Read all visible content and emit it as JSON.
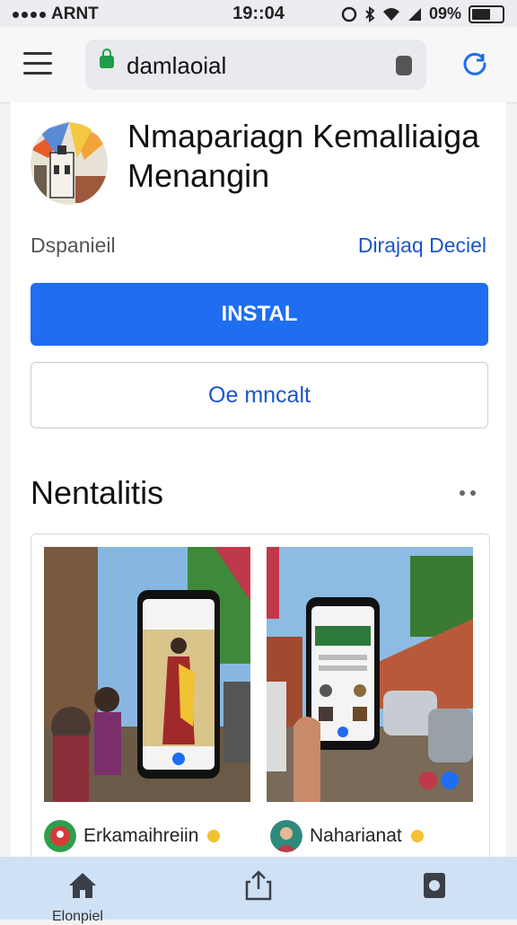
{
  "status_bar": {
    "carrier": "ARNT",
    "time": "19::04",
    "battery_percent": "09%"
  },
  "address_bar": {
    "url": "damlaoial"
  },
  "app": {
    "title": "Nmapariagn Kemalliaiga Menangin",
    "developer": "Dspanieil",
    "category_link": "Dirajaq Deciel"
  },
  "buttons": {
    "install": "INSTAL",
    "secondary": "Oe mncalt"
  },
  "screenshots_section": {
    "title": "Nentalitis",
    "developers": [
      {
        "name": "Erkamaihreiin"
      },
      {
        "name": "Naharianat"
      }
    ]
  },
  "bottom_nav": {
    "home_label": "Elonpiel"
  },
  "colors": {
    "accent": "#1f6df0",
    "link": "#1a56c9",
    "nav_bg": "#cfe1f5"
  },
  "icons": [
    "menu-icon",
    "lock-icon",
    "share-icon",
    "reload-icon",
    "home-icon",
    "upload-icon",
    "tabs-icon",
    "more-icon"
  ]
}
